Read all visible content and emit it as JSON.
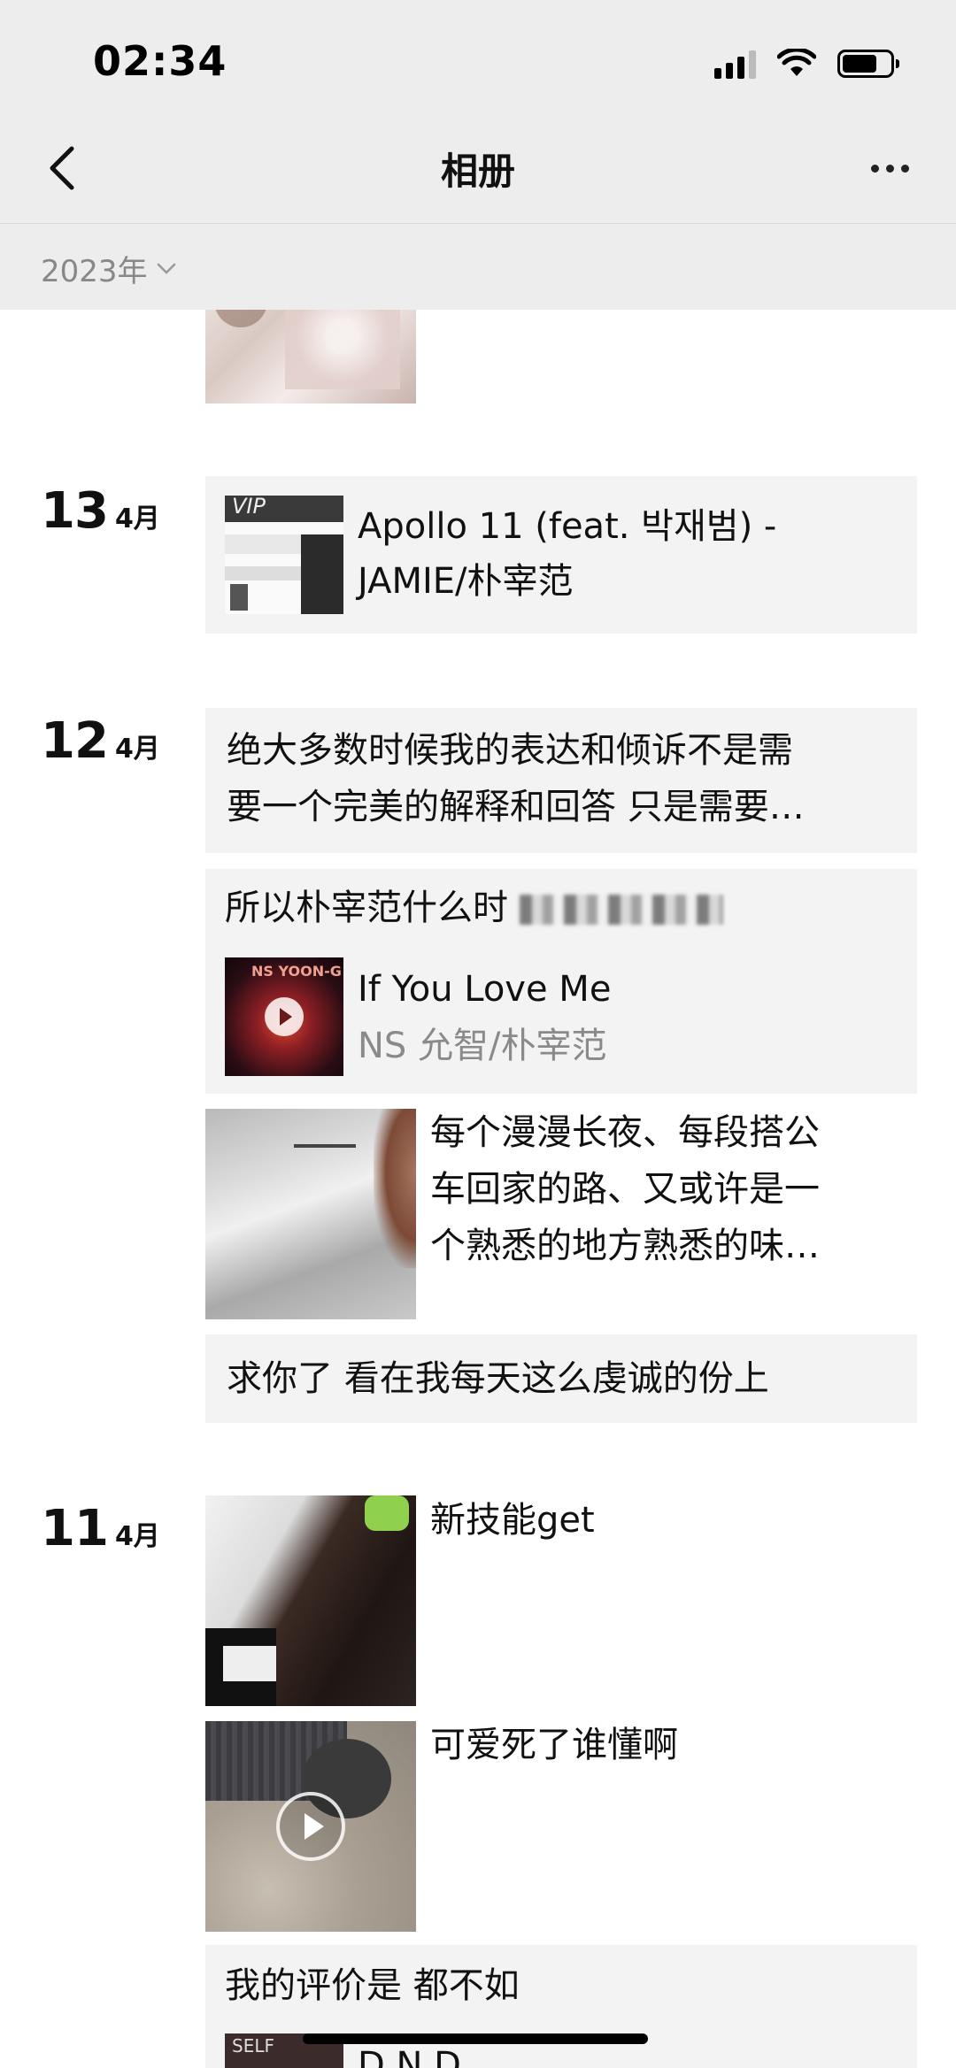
{
  "status": {
    "time": "02:34"
  },
  "nav": {
    "title": "相册"
  },
  "year_selector": {
    "label": "2023年"
  },
  "entries": {
    "apr13": {
      "day": "13",
      "month": "4月",
      "music": {
        "badge": "VIP",
        "title": "Apollo 11 (feat. 박재범) - JAMIE/朴宰范"
      }
    },
    "apr12": {
      "day": "12",
      "month": "4月",
      "text1": {
        "line1": "绝大多数时候我的表达和倾诉不是需",
        "line2": "要一个完美的解释和回答 只是需要…"
      },
      "music_post": {
        "caption": "所以朴宰范什么时",
        "cover_text": "NS YOON-G",
        "song": "If You Love Me",
        "artist": "NS 允智/朴宰范"
      },
      "photo_post": {
        "line1": "每个漫漫长夜、每段搭公",
        "line2": "车回家的路、又或许是一",
        "line3": "个熟悉的地方熟悉的味…"
      },
      "text2": "求你了 看在我每天这么虔诚的份上"
    },
    "apr11": {
      "day": "11",
      "month": "4月",
      "post1": "新技能get",
      "post2": "可爱死了谁懂啊",
      "post3": {
        "caption": "我的评价是 都不如",
        "song_partial": "D.N.D",
        "cover_text": "SELF"
      }
    }
  }
}
